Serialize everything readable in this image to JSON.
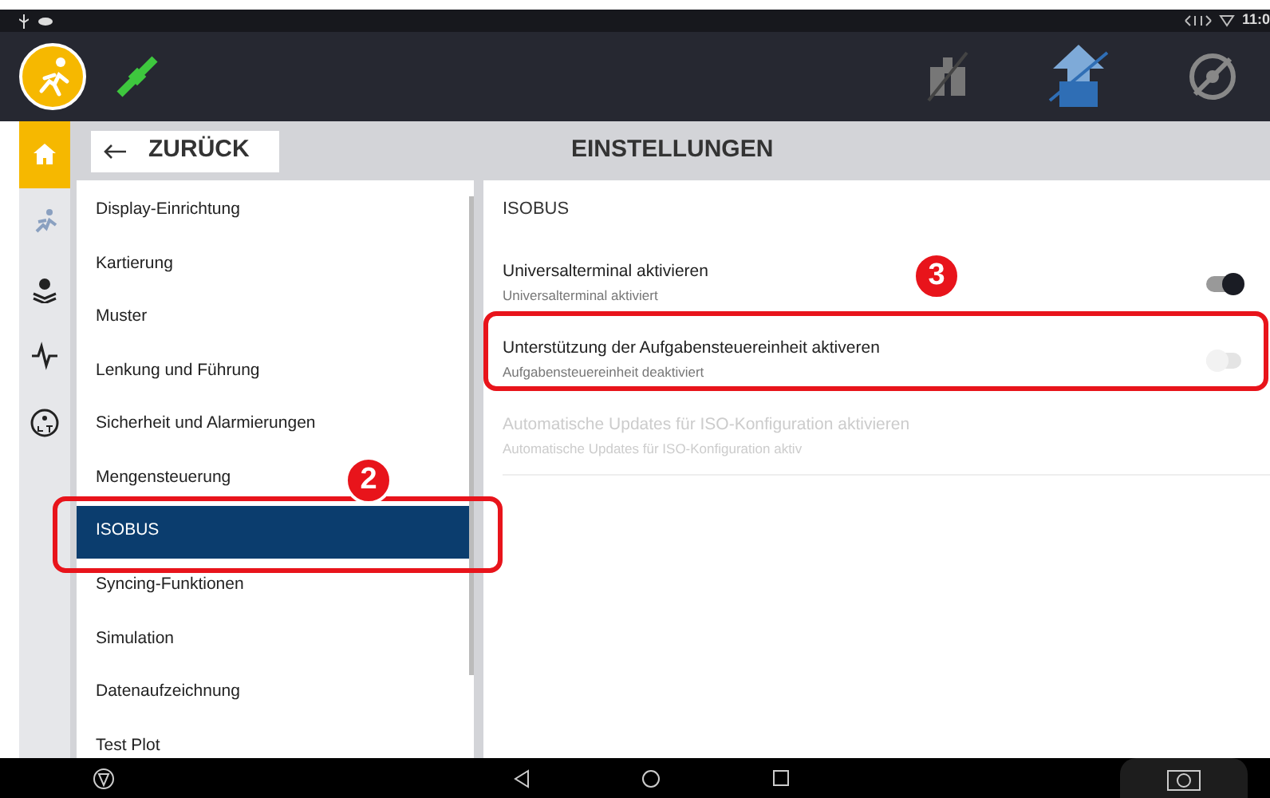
{
  "status_bar": {
    "time": "11:0"
  },
  "rail": {
    "items": [
      {
        "kind": "home",
        "selected": true
      },
      {
        "kind": "run",
        "selected": false
      },
      {
        "kind": "gear",
        "selected": false
      },
      {
        "kind": "pulse",
        "selected": false
      },
      {
        "kind": "ut",
        "selected": false
      }
    ]
  },
  "header": {
    "back_label": "ZURÜCK",
    "title": "EINSTELLUNGEN"
  },
  "menu": {
    "items": [
      {
        "label": "Display-Einrichtung",
        "selected": false
      },
      {
        "label": "Kartierung",
        "selected": false
      },
      {
        "label": "Muster",
        "selected": false
      },
      {
        "label": "Lenkung und Führung",
        "selected": false
      },
      {
        "label": "Sicherheit und Alarmierungen",
        "selected": false
      },
      {
        "label": "Mengensteuerung",
        "selected": false
      },
      {
        "label": "ISOBUS",
        "selected": true
      },
      {
        "label": "Syncing-Funktionen",
        "selected": false
      },
      {
        "label": "Simulation",
        "selected": false
      },
      {
        "label": "Datenaufzeichnung",
        "selected": false
      },
      {
        "label": "Test Plot",
        "selected": false
      }
    ]
  },
  "section": {
    "title": "ISOBUS",
    "settings": [
      {
        "title": "Universalterminal aktivieren",
        "subtitle": "Universalterminal aktiviert",
        "on": true,
        "disabled": false
      },
      {
        "title": "Unterstützung der Aufgabensteuereinheit aktiveren",
        "subtitle": "Aufgabensteuereinheit deaktiviert",
        "on": false,
        "disabled": false
      },
      {
        "title": "Automatische Updates für ISO-Konfiguration aktivieren",
        "subtitle": "Automatische Updates für ISO-Konfiguration aktiv",
        "disabled": true
      }
    ]
  },
  "annotations": [
    {
      "number": "2",
      "kind": "menu"
    },
    {
      "number": "3",
      "kind": "setting"
    }
  ]
}
